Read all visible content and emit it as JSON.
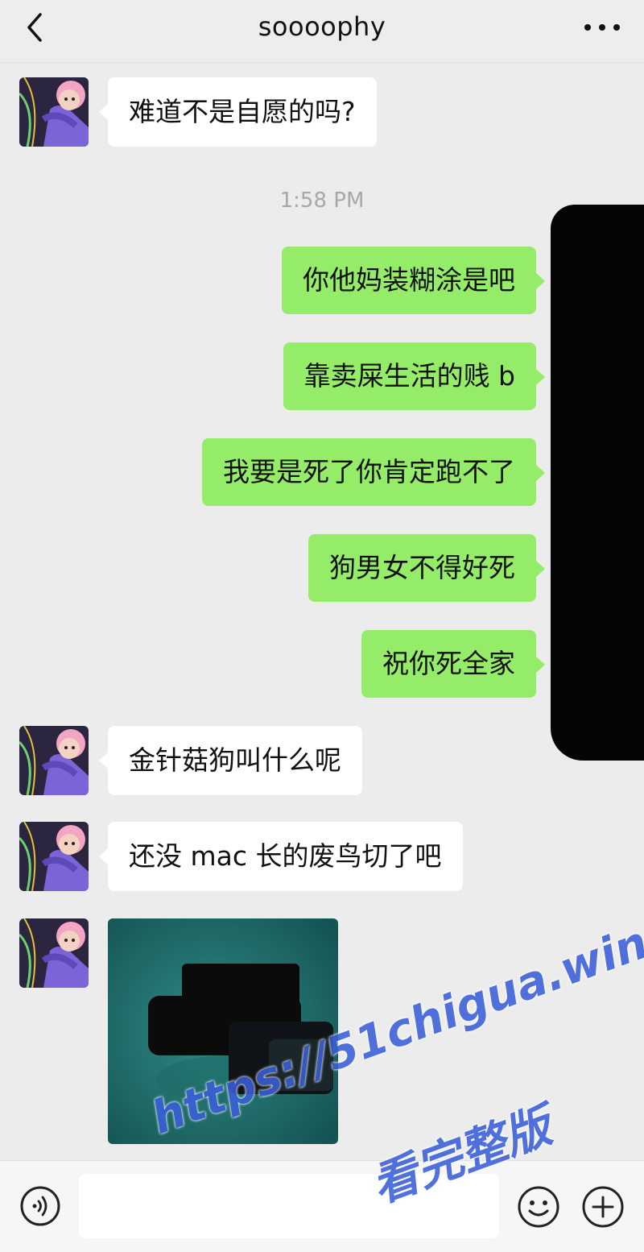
{
  "header": {
    "title": "soooophy",
    "back_icon": "chevron-left-icon",
    "more_icon": "more-dots-icon"
  },
  "messages": [
    {
      "side": "in",
      "text": "难道不是自愿的吗?"
    },
    {
      "side": "out",
      "text": "你他妈装糊涂是吧"
    },
    {
      "side": "out",
      "text": "靠卖屎生活的贱 b"
    },
    {
      "side": "out",
      "text": "我要是死了你肯定跑不了"
    },
    {
      "side": "out",
      "text": "狗男女不得好死"
    },
    {
      "side": "out",
      "text": "祝你死全家"
    },
    {
      "side": "in",
      "text": "金针菇狗叫什么呢"
    },
    {
      "side": "in",
      "text": "还没 mac 长的废鸟切了吧"
    }
  ],
  "timestamp": "1:58 PM",
  "input_bar": {
    "value": "",
    "voice_icon": "voice-icon",
    "emoji_icon": "emoji-icon",
    "plus_icon": "plus-icon"
  },
  "watermark": {
    "url": "https://51chigua.win",
    "text": "看完整版"
  },
  "colors": {
    "incoming_bubble": "#ffffff",
    "outgoing_bubble": "#95ec69",
    "background": "#ececec",
    "watermark": "#3a5fd9"
  }
}
